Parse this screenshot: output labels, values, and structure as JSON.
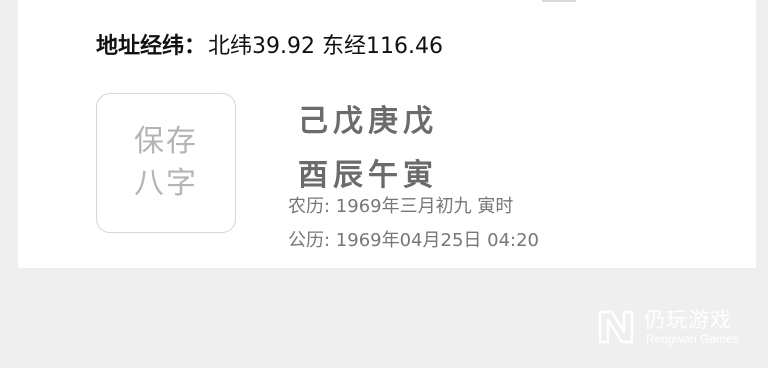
{
  "address": {
    "label": "地址经纬：",
    "value": "北纬39.92 东经116.46"
  },
  "save_button": {
    "label": "保存八字"
  },
  "bazi": {
    "row1": "己戊庚戊",
    "row2": "酉辰午寅"
  },
  "lunar": "农历: 1969年三月初九 寅时",
  "solar": "公历: 1969年04月25日 04:20",
  "watermark": {
    "title": "仍玩游戏",
    "subtitle": "Rengwan Games"
  }
}
